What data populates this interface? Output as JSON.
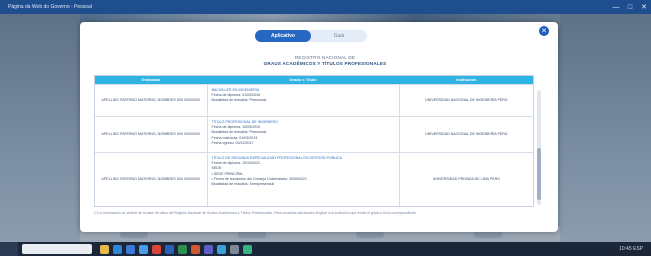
{
  "window": {
    "title": "Página da Web do Governo - Pessoal",
    "controls": [
      "—",
      "□",
      "✕"
    ]
  },
  "modal": {
    "close_label": "✕",
    "tabs": [
      {
        "label": "Aplicativo",
        "active": true
      },
      {
        "label": "Guia",
        "active": false
      }
    ],
    "heading1": "REGISTRO NACIONAL DE",
    "heading2": "GRAUS ACADÊMICOS Y TÍTULOS PROFESIONALES",
    "table": {
      "headers": [
        "Graduado",
        "Grado o Título",
        "Institución"
      ],
      "rows": [
        {
          "name": "APELLIDO PATERNO MATERNO, NOMBRES DNI 00000000",
          "degree_lines": [
            "BACHILLER EN INGENIERÍA",
            "Fecha de diploma: 01/03/2018",
            "Modalidad de estudios: Presencial"
          ],
          "institution": "UNIVERSIDAD NACIONAL DE INGENIERÍA PERÚ"
        },
        {
          "name": "APELLIDO PATERNO MATERNO, NOMBRES DNI 00000000",
          "degree_lines": [
            "TÍTULO PROFESIONAL DE INGENIERO",
            "Fecha de diploma: 15/09/2019",
            "Modalidad de estudios: Presencial",
            "Fecha matrícula: 01/03/2013",
            "Fecha egreso: 20/12/2017"
          ],
          "institution": "UNIVERSIDAD NACIONAL DE INGENIERÍA PERÚ"
        },
        {
          "name": "APELLIDO PATERNO MATERNO, NOMBRES DNI 00000000",
          "degree_lines": [
            "TÍTULO DE SEGUNDA ESPECIALIDAD PROFESIONAL EN GESTIÓN PÚBLICA",
            "Fecha de diploma: 10/10/2021",
            "SEDE:",
            "• SEDE PRINCIPAL",
            "• Fecha de resolución del Consejo Universitario: 30/09/2021",
            "Modalidad de estudios: Semipresencial"
          ],
          "institution": "UNIVERSIDAD PRIVADA DE LIMA PERÚ"
        }
      ]
    },
    "footnote": "(*) La información se obtiene de la base de datos del Registro Nacional de Grados Académicos y Títulos Profesionales. Para consultas adicionales dirigirse a la institución que emitió el grado o título correspondiente."
  },
  "taskbar": {
    "clock": "10:45  ESP"
  },
  "colors": {
    "accent": "#2667c4",
    "table_header": "#2fb3e3",
    "titlebar": "#1f4e8f",
    "taskbar": "#1b2738"
  }
}
